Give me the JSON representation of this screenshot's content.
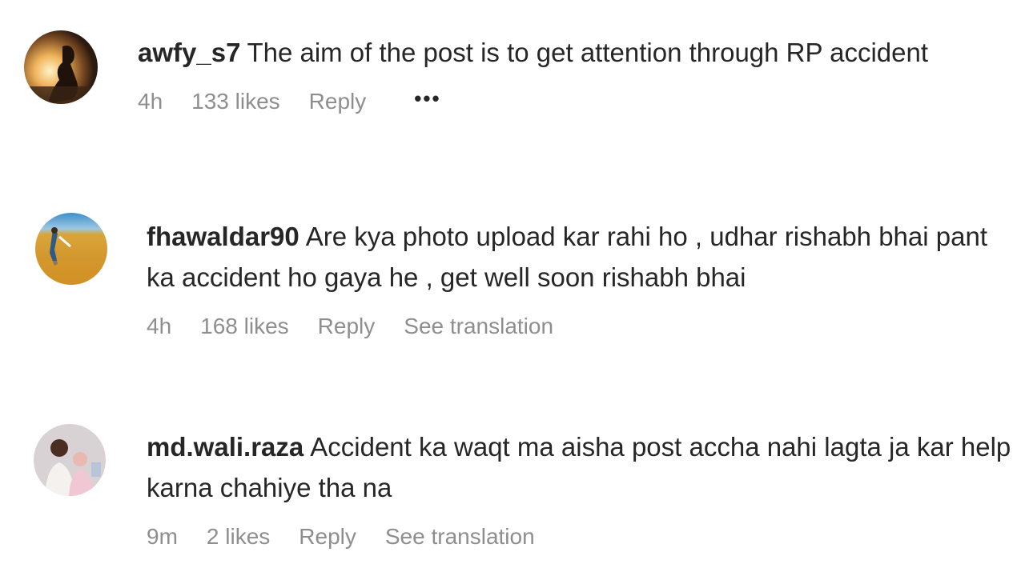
{
  "comments": [
    {
      "username": "awfy_s7",
      "text": "The aim of the post is to get attention through RP accident",
      "time": "4h",
      "likes": "133 likes",
      "reply": "Reply",
      "more": "•••"
    },
    {
      "username": "fhawaldar90",
      "text": "Are kya photo upload kar rahi ho , udhar rishabh bhai pant ka accident ho gaya he , get well soon rishabh bhai",
      "time": "4h",
      "likes": "168 likes",
      "reply": "Reply",
      "translate": "See translation"
    },
    {
      "username": "md.wali.raza",
      "text": "Accident ka waqt ma aisha post accha nahi lagta ja kar help karna chahiye tha na",
      "time": "9m",
      "likes": "2 likes",
      "reply": "Reply",
      "translate": "See translation"
    }
  ],
  "colors": {
    "text": "#262626",
    "muted": "#8e8e8e"
  }
}
